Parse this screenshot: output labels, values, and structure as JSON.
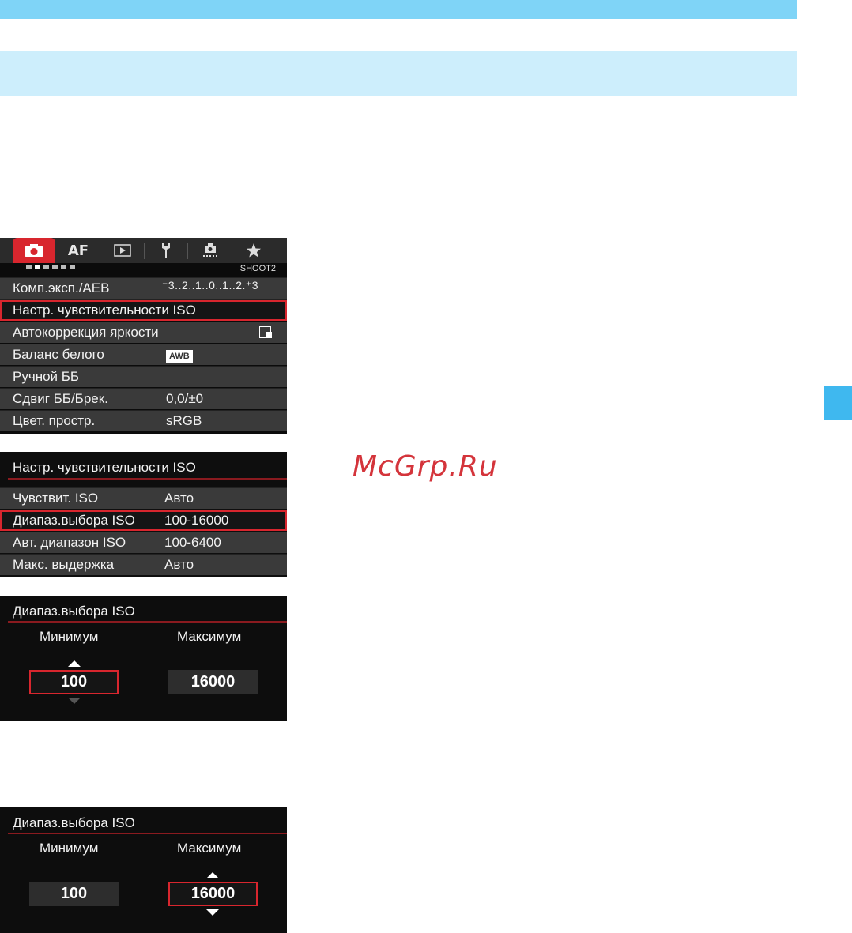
{
  "watermark": "McGrp.Ru",
  "menu_screen": {
    "tabs": [
      {
        "icon": "camera-icon"
      },
      {
        "label": "AF"
      },
      {
        "icon": "playback-icon"
      },
      {
        "icon": "wrench-icon"
      },
      {
        "icon": "custom-function-icon"
      },
      {
        "icon": "star-icon"
      }
    ],
    "page_label": "SHOOT2",
    "items": [
      {
        "label": "Комп.эксп./AEB",
        "value": "⁻3..2..1..̲$0..1..2.⁺3"
      },
      {
        "label": "Настр. чувствительности ISO",
        "value": ""
      },
      {
        "label": "Автокоррекция яркости",
        "value": ""
      },
      {
        "label": "Баланс белого",
        "value": "AWB"
      },
      {
        "label": "Ручной ББ",
        "value": ""
      },
      {
        "label": "Сдвиг ББ/Брек.",
        "value": "0,0/±0"
      },
      {
        "label": "Цвет. простр.",
        "value": "sRGB"
      }
    ],
    "exposure_scale": "⁻3..2..1..0..1..2.⁺3"
  },
  "iso_settings_screen": {
    "title": "Настр. чувствительности ISO",
    "items": [
      {
        "label": "Чувствит. ISO",
        "value": "Авто"
      },
      {
        "label": "Диапаз.выбора ISO",
        "value": "100-16000"
      },
      {
        "label": "Авт. диапазон ISO",
        "value": "100-6400"
      },
      {
        "label": "Макс. выдержка",
        "value": "Авто"
      }
    ]
  },
  "iso_range_min_screen": {
    "title": "Диапаз.выбора ISO",
    "min_label": "Минимум",
    "max_label": "Максимум",
    "min_value": "100",
    "max_value": "16000"
  },
  "iso_range_max_screen": {
    "title": "Диапаз.выбора ISO",
    "min_label": "Минимум",
    "max_label": "Максимум",
    "min_value": "100",
    "max_value": "16000"
  },
  "colors": {
    "accent_red": "#d8262e",
    "band_blue": "#7fd4f7",
    "band_light_blue": "#cdeefc",
    "side_tab_blue": "#3fb8ef"
  }
}
